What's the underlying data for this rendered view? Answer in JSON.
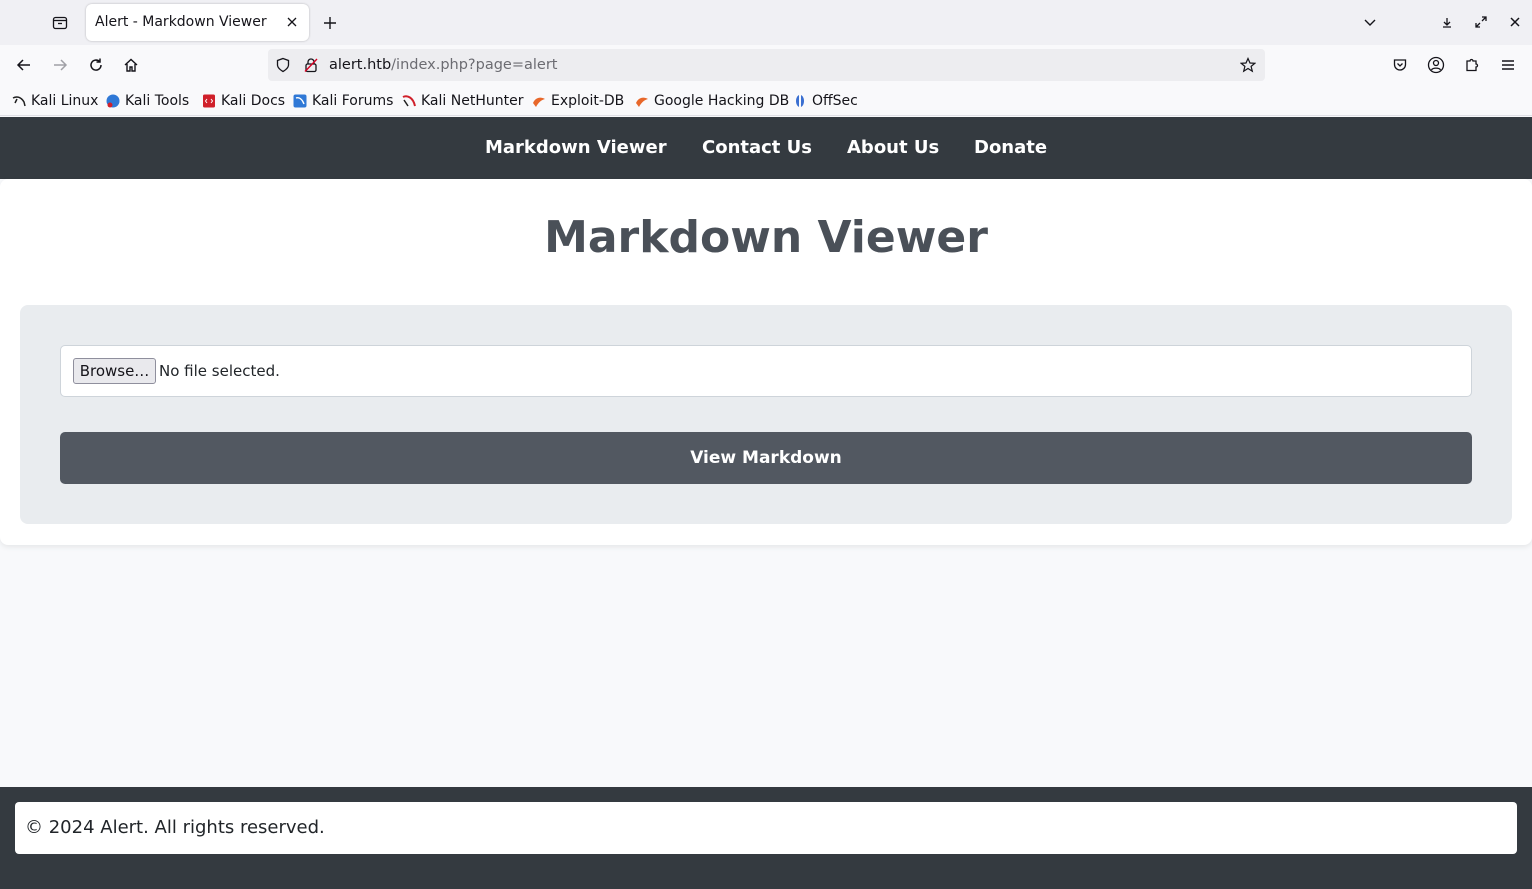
{
  "browser": {
    "tab_title": "Alert - Markdown Viewer",
    "url_host": "alert.htb",
    "url_path": "/index.php?page=alert",
    "bookmarks": [
      {
        "label": "Kali Linux",
        "icon": "kali-dragon-icon",
        "color": "#1f1f1f"
      },
      {
        "label": "Kali Tools",
        "icon": "kali-tools-icon",
        "color": "#2f78d6"
      },
      {
        "label": "Kali Docs",
        "icon": "kali-docs-icon",
        "color": "#d0202a"
      },
      {
        "label": "Kali Forums",
        "icon": "kali-forums-icon",
        "color": "#2f78d6"
      },
      {
        "label": "Kali NetHunter",
        "icon": "kali-nethunter-icon",
        "color": "#d0202a"
      },
      {
        "label": "Exploit-DB",
        "icon": "exploit-db-icon",
        "color": "#e8672a"
      },
      {
        "label": "Google Hacking DB",
        "icon": "google-hacking-db-icon",
        "color": "#e8672a"
      },
      {
        "label": "OffSec",
        "icon": "offsec-icon",
        "color": "#3a6fd1"
      }
    ]
  },
  "site": {
    "nav": [
      "Markdown Viewer",
      "Contact Us",
      "About Us",
      "Donate"
    ],
    "title": "Markdown Viewer",
    "browse_label": "Browse…",
    "file_status": "No file selected.",
    "submit_label": "View Markdown",
    "footer": "© 2024 Alert. All rights reserved."
  },
  "colors": {
    "nav_bg": "#343a40",
    "button_bg": "#525861",
    "form_bg": "#e9ecef"
  }
}
